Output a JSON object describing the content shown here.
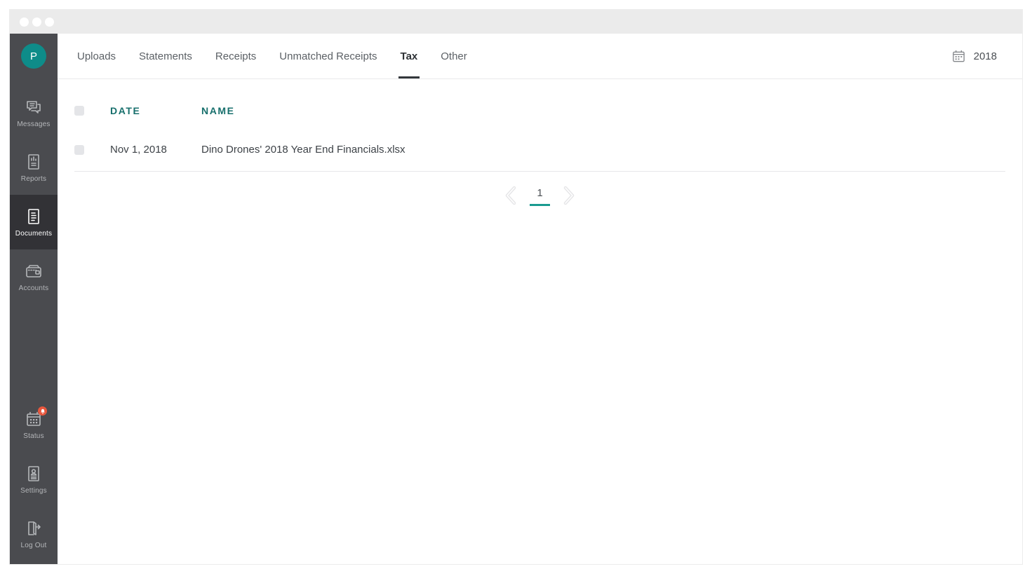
{
  "window": {
    "titlebar": {
      "traffic_lights": 3
    }
  },
  "sidebar": {
    "avatar_initial": "P",
    "items": [
      {
        "label": "Messages",
        "icon": "messages-icon",
        "active": false
      },
      {
        "label": "Reports",
        "icon": "reports-icon",
        "active": false
      },
      {
        "label": "Documents",
        "icon": "documents-icon",
        "active": true
      },
      {
        "label": "Accounts",
        "icon": "accounts-icon",
        "active": false
      }
    ],
    "bottom_items": [
      {
        "label": "Status",
        "icon": "status-calendar-icon",
        "badge": "bell-notification"
      },
      {
        "label": "Settings",
        "icon": "settings-id-card-icon"
      },
      {
        "label": "Log Out",
        "icon": "logout-door-icon"
      }
    ]
  },
  "tabs": [
    {
      "label": "Uploads",
      "active": false
    },
    {
      "label": "Statements",
      "active": false
    },
    {
      "label": "Receipts",
      "active": false
    },
    {
      "label": "Unmatched Receipts",
      "active": false
    },
    {
      "label": "Tax",
      "active": true
    },
    {
      "label": "Other",
      "active": false
    }
  ],
  "date_filter": {
    "icon": "calendar-icon",
    "value": "2018"
  },
  "table": {
    "columns": {
      "date": "DATE",
      "name": "NAME"
    },
    "rows": [
      {
        "date": "Nov 1, 2018",
        "name": "Dino Drones' 2018 Year End Financials.xlsx"
      }
    ]
  },
  "pagination": {
    "current_page": "1",
    "prev": "chevron-left",
    "next": "chevron-right"
  },
  "colors": {
    "brand_teal": "#0e8c89",
    "header_teal": "#176f6c",
    "underline_teal": "#1a9b90",
    "sidebar_bg": "#4a4b4f",
    "sidebar_active_bg": "#323236",
    "badge_orange": "#e8573d",
    "titlebar_gray": "#ebebeb"
  }
}
